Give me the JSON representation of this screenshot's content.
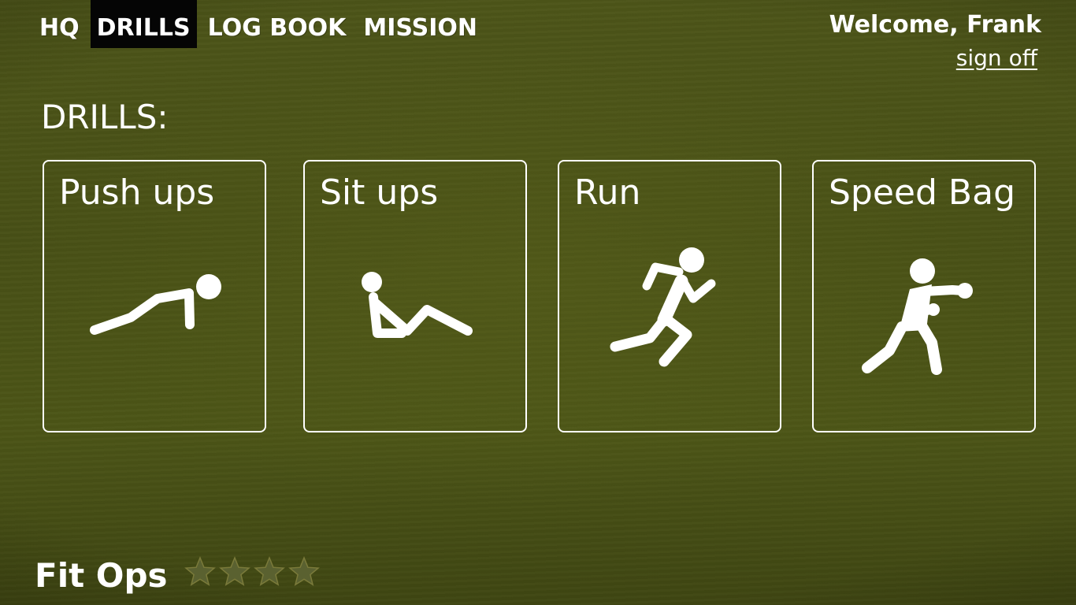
{
  "nav": {
    "items": [
      {
        "label": "HQ"
      },
      {
        "label": "DRILLS"
      },
      {
        "label": "LOG BOOK"
      },
      {
        "label": "MISSION"
      }
    ],
    "active": "DRILLS"
  },
  "user": {
    "welcome": "Welcome, Frank",
    "sign_off": "sign off"
  },
  "page": {
    "title": "DRILLS:"
  },
  "drills": [
    {
      "label": "Push ups",
      "icon": "push-up-icon"
    },
    {
      "label": "Sit ups",
      "icon": "sit-up-icon"
    },
    {
      "label": "Run",
      "icon": "run-icon"
    },
    {
      "label": "Speed Bag",
      "icon": "boxing-icon"
    }
  ],
  "footer": {
    "logo": "Fit Ops",
    "stars_filled": 0,
    "stars_total": 4
  },
  "colors": {
    "background": "#4a5217",
    "text": "#ffffff",
    "active_tab": "#050505",
    "star_fill": "#5a6130",
    "star_outline": "#7a7a3a"
  }
}
